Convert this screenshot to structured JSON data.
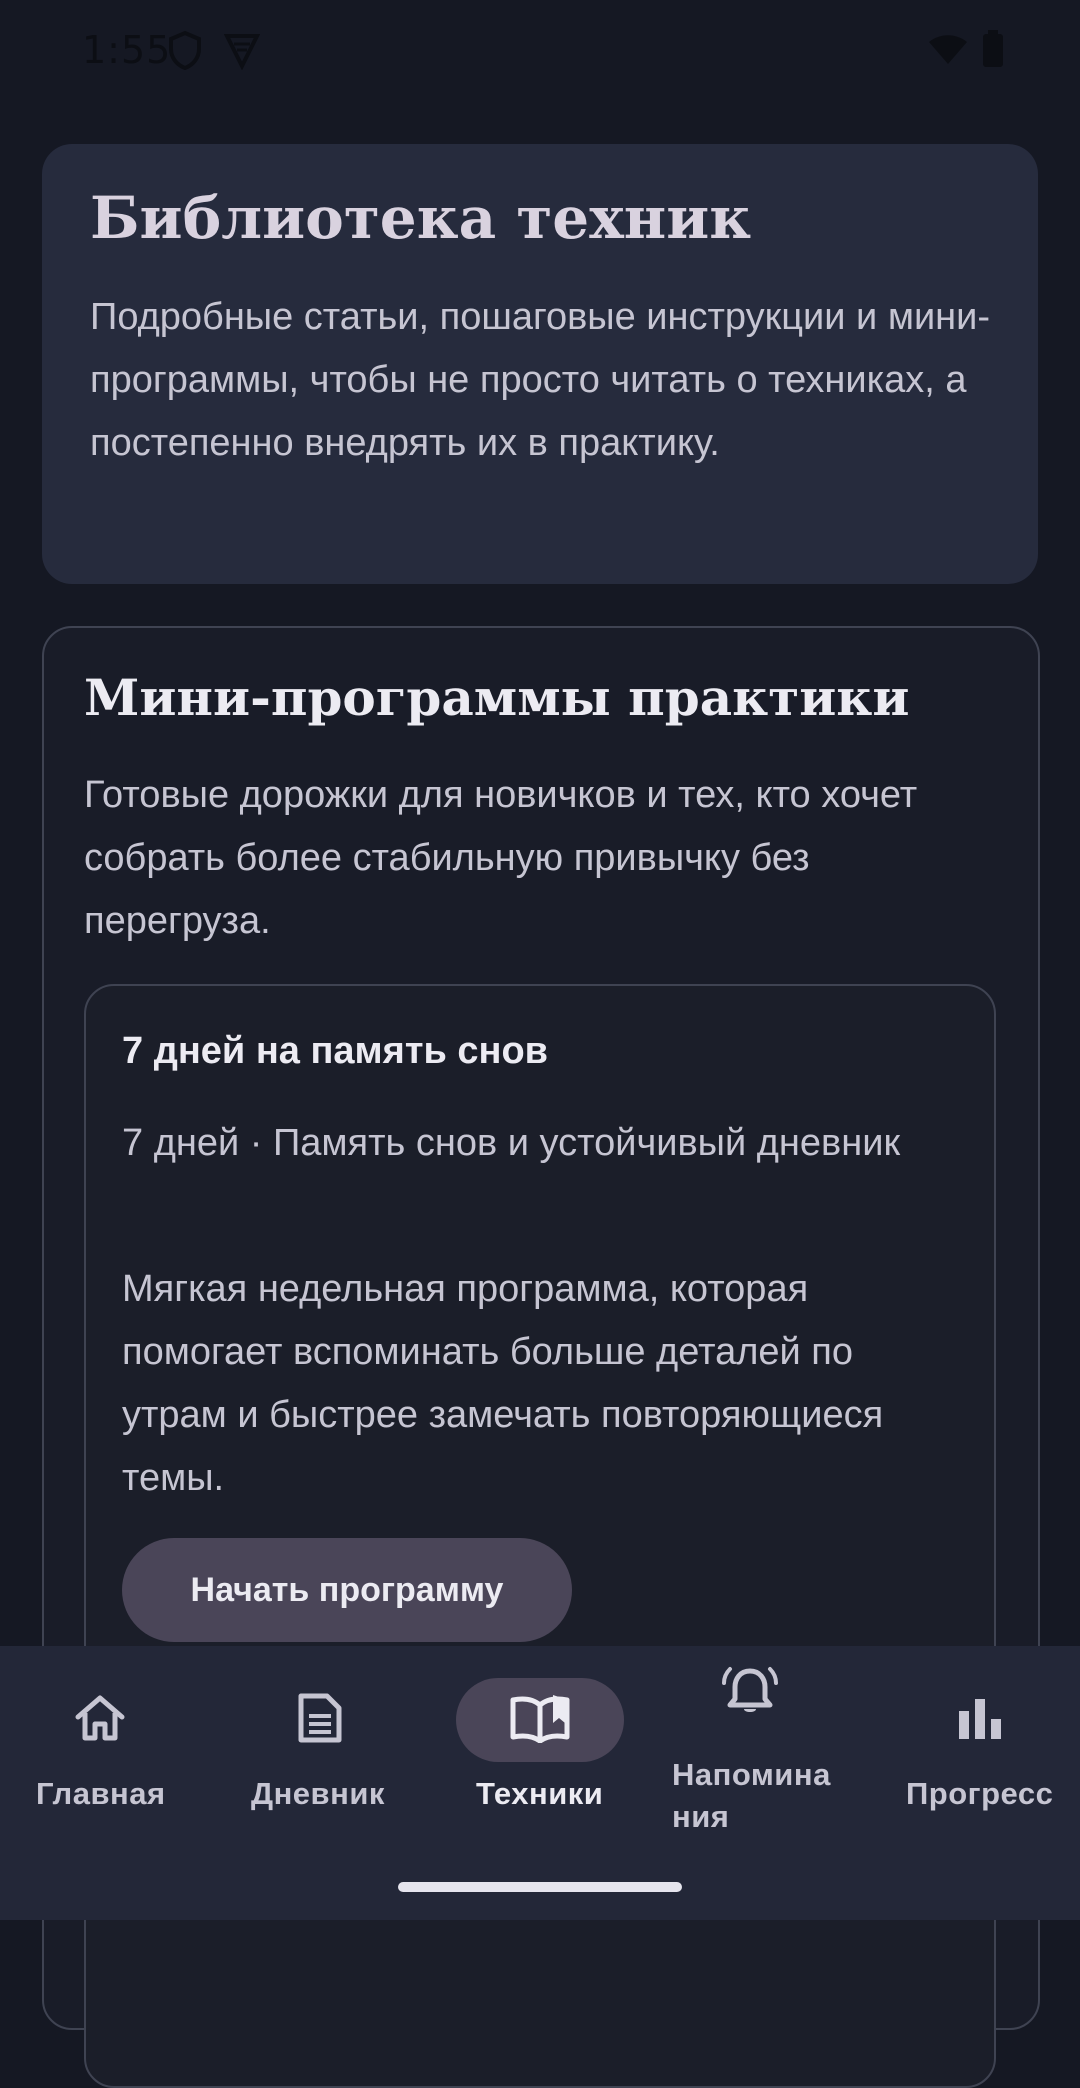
{
  "status_bar": {
    "time": "1:55",
    "icons": [
      "shield-icon",
      "vpn-icon",
      "wifi-icon",
      "battery-icon"
    ]
  },
  "intro": {
    "title": "Библиотека техник",
    "text": "Подробные статьи, пошаговые инструкции и мини-программы, чтобы не просто читать о техниках, а постепенно внедрять их в практику."
  },
  "programs": {
    "title": "Мини-программы практики",
    "text": "Готовые дорожки для новичков и тех, кто хочет собрать более стабильную привычку без перегруза.",
    "items": [
      {
        "title": "7 дней на память снов",
        "meta": "7 дней · Память снов и устойчивый дневник",
        "description": "Мягкая недельная программа, которая помогает вспоминать больше деталей по утрам и быстрее замечать повторяющиеся темы.",
        "button": "Начать программу"
      }
    ]
  },
  "nav": {
    "active": "Техники",
    "items": [
      {
        "label": "Главная",
        "icon": "home-icon"
      },
      {
        "label": "Дневник",
        "icon": "journal-icon"
      },
      {
        "label": "Техники",
        "icon": "book-icon"
      },
      {
        "label": "Напомина ния",
        "icon": "bell-icon"
      },
      {
        "label": "Прогресс",
        "icon": "bar-chart-icon"
      }
    ]
  },
  "colors": {
    "background": "#151823",
    "card": "#262b3d",
    "accent_pill": "#4a4558",
    "nav_background": "#232738"
  }
}
